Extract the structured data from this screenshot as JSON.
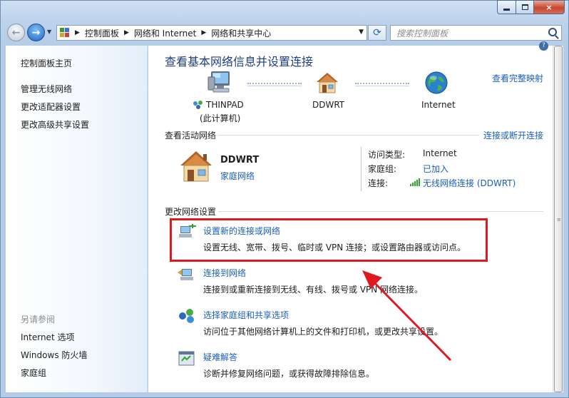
{
  "window": {
    "controls": {
      "minimize": "minimize",
      "maximize": "maximize",
      "close": "×"
    }
  },
  "nav": {
    "breadcrumbs": [
      "控制面板",
      "网络和 Internet",
      "网络和共享中心"
    ],
    "search_placeholder": "搜索控制面板"
  },
  "sidebar": {
    "top_links": [
      "控制面板主页",
      "管理无线网络",
      "更改适配器设置",
      "更改高级共享设置"
    ],
    "see_also_heading": "另请参阅",
    "see_also_links": [
      "Internet 选项",
      "Windows 防火墙",
      "家庭组"
    ]
  },
  "main": {
    "title": "查看基本网络信息并设置连接",
    "full_map_link": "查看完整映射",
    "map": {
      "computer_name": "THINPAD",
      "computer_sub": "(此计算机)",
      "router_name": "DDWRT",
      "internet_name": "Internet"
    },
    "active_networks_heading": "查看活动网络",
    "connect_disconnect_link": "连接或断开连接",
    "network": {
      "name": "DDWRT",
      "type_link": "家庭网络",
      "access_type_label": "访问类型:",
      "access_type_value": "Internet",
      "homegroup_label": "家庭组:",
      "homegroup_value": "已加入",
      "connection_label": "连接:",
      "connection_value": "无线网络连接 (DDWRT)"
    },
    "change_settings_heading": "更改网络设置",
    "tasks": [
      {
        "title": "设置新的连接或网络",
        "desc": "设置无线、宽带、拨号、临时或 VPN 连接；或设置路由器或访问点。"
      },
      {
        "title": "连接到网络",
        "desc": "连接到或重新连接到无线、有线、拨号或 VPN 网络连接。"
      },
      {
        "title": "选择家庭组和共享选项",
        "desc": "访问位于其他网络计算机上的文件和打印机，或更改共享设置。"
      },
      {
        "title": "疑难解答",
        "desc": "诊断并修复网络问题，或获得故障排除信息。"
      }
    ]
  },
  "colors": {
    "link": "#1a5ebe",
    "title": "#1e3e82",
    "highlight_box": "#e0181e"
  }
}
